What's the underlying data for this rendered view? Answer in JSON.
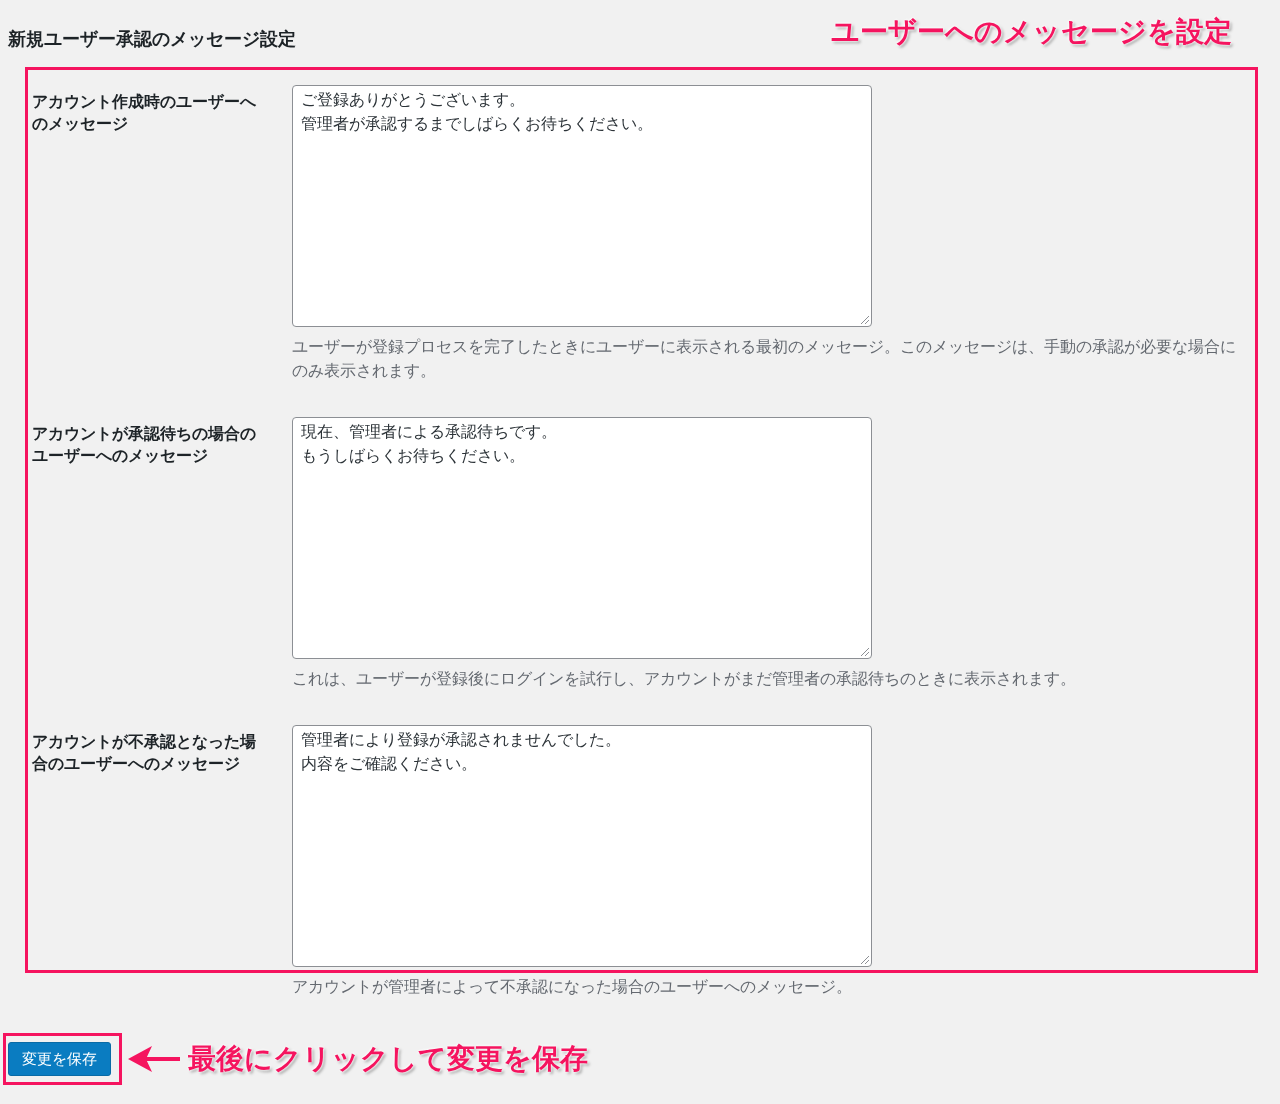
{
  "page_title": "新規ユーザー承認のメッセージ設定",
  "header_callout": {
    "text": "ユーザーへのメッセージを設定"
  },
  "fields": [
    {
      "label": "アカウント作成時のユーザーへのメッセージ",
      "lines": [
        "ご登録ありがとうございます。",
        "管理者が承認するまでしばらくお待ちください。"
      ],
      "description": "ユーザーが登録プロセスを完了したときにユーザーに表示される最初のメッセージ。このメッセージは、手動の承認が必要な場合にのみ表示されます。"
    },
    {
      "label": "アカウントが承認待ちの場合のユーザーへのメッセージ",
      "lines": [
        "現在、管理者による承認待ちです。",
        "もうしばらくお待ちください。"
      ],
      "description": "これは、ユーザーが登録後にログインを試行し、アカウントがまだ管理者の承認待ちのときに表示されます。"
    },
    {
      "label": "アカウントが不承認となった場合のユーザーへのメッセージ",
      "lines": [
        "管理者により登録が承認されませんでした。",
        "内容をご確認ください。"
      ],
      "description": "アカウントが管理者によって不承認になった場合のユーザーへのメッセージ。"
    }
  ],
  "save_button": {
    "label": "変更を保存"
  },
  "save_callout": {
    "text": "最後にクリックして変更を保存"
  }
}
